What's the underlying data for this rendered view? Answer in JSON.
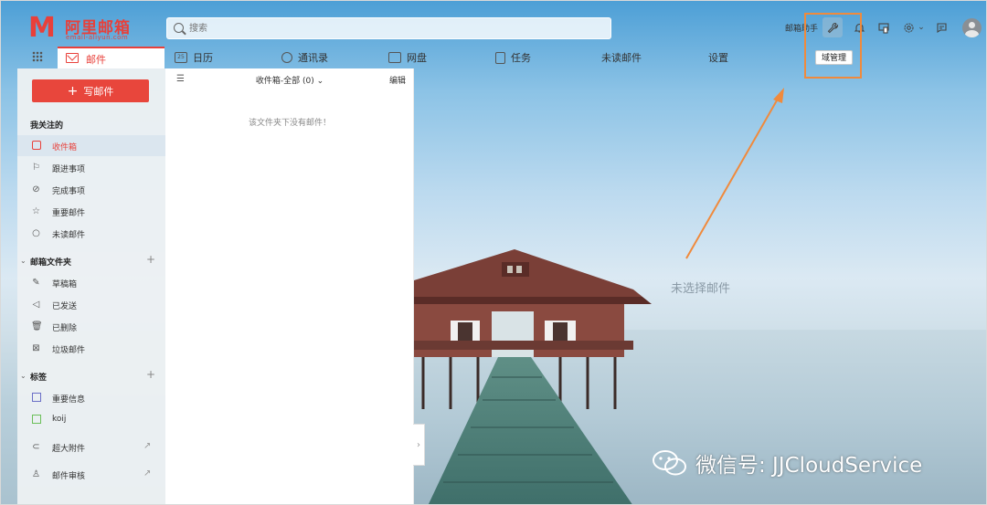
{
  "brand": {
    "logo_letter": "M",
    "name": "阿里邮箱",
    "domain": "email-aliyun.com",
    "accent_color": "#e8403a"
  },
  "search": {
    "placeholder": "搜索"
  },
  "topbar": {
    "assistant_label": "邮箱助手",
    "tools": [
      "wrench-icon",
      "bell-icon",
      "device-icon",
      "gear-icon",
      "chevron-down-icon",
      "message-icon"
    ],
    "tooltip": "域管理"
  },
  "nav": {
    "mail_tab": "邮件",
    "calendar_day": "25",
    "items": [
      {
        "label": "日历",
        "icon": "calendar-icon"
      },
      {
        "label": "通讯录",
        "icon": "contacts-icon"
      },
      {
        "label": "网盘",
        "icon": "drive-icon"
      },
      {
        "label": "任务",
        "icon": "task-icon"
      },
      {
        "label": "未读邮件",
        "icon": ""
      },
      {
        "label": "设置",
        "icon": ""
      }
    ]
  },
  "sidebar": {
    "compose_label": "写邮件",
    "followed_title": "我关注的",
    "followed": [
      {
        "label": "收件箱",
        "icon": "inbox-icon",
        "active": true
      },
      {
        "label": "跟进事项",
        "icon": "flag-icon",
        "active": false
      },
      {
        "label": "完成事项",
        "icon": "check-circle-icon",
        "active": false
      },
      {
        "label": "重要邮件",
        "icon": "star-icon",
        "active": false
      },
      {
        "label": "未读邮件",
        "icon": "circle-icon",
        "active": false
      }
    ],
    "folders_title": "邮箱文件夹",
    "folders": [
      {
        "label": "草稿箱",
        "icon": "draft-icon"
      },
      {
        "label": "已发送",
        "icon": "send-icon"
      },
      {
        "label": "已删除",
        "icon": "trash-icon"
      },
      {
        "label": "垃圾邮件",
        "icon": "spam-icon"
      }
    ],
    "tags_title": "标签",
    "tags": [
      {
        "label": "重要信息",
        "color": "#6b6fc7"
      },
      {
        "label": "koij",
        "color": "#6bbf59"
      }
    ],
    "extras": [
      {
        "label": "超大附件",
        "icon": "paperclip-icon"
      },
      {
        "label": "邮件审核",
        "icon": "stamp-icon"
      }
    ]
  },
  "list": {
    "folder_label": "收件箱-全部 (0)",
    "edit_label": "编辑",
    "empty_message": "该文件夹下没有邮件！"
  },
  "reader": {
    "no_selection": "未选择邮件"
  },
  "watermark": {
    "text": "微信号: JJCloudService"
  }
}
